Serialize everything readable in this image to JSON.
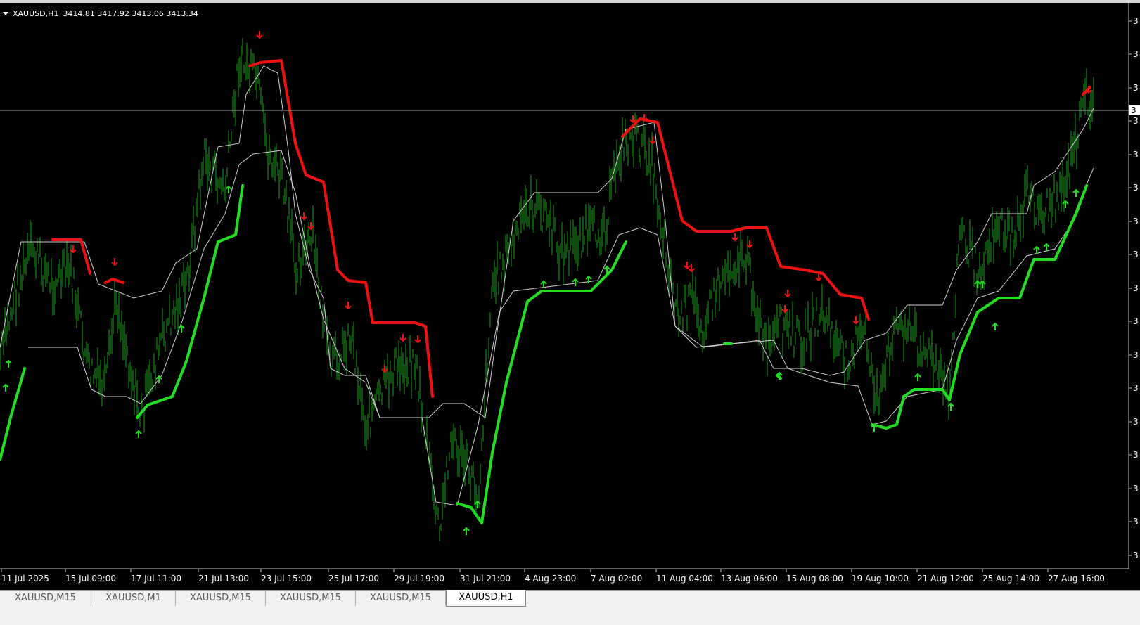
{
  "header": {
    "symbol": "XAUUSD,H1",
    "ohlc": "3414.81 3417.92 3413.06 3413.34"
  },
  "time_axis": {
    "labels": [
      "11 Jul 2025",
      "15 Jul 09:00",
      "17 Jul 11:00",
      "21 Jul 13:00",
      "23 Jul 15:00",
      "25 Jul 17:00",
      "29 Jul 19:00",
      "31 Jul 21:00",
      "4 Aug 23:00",
      "7 Aug 02:00",
      "11 Aug 04:00",
      "13 Aug 06:00",
      "15 Aug 08:00",
      "19 Aug 10:00",
      "21 Aug 12:00",
      "25 Aug 14:00",
      "27 Aug 16:00"
    ]
  },
  "price_axis": {
    "visible_prefix": "3",
    "current_price_marker": "3"
  },
  "tabs": [
    {
      "label": "XAUUSD,M15",
      "active": false
    },
    {
      "label": "XAUUSD,M1",
      "active": false
    },
    {
      "label": "XAUUSD,M15",
      "active": false
    },
    {
      "label": "XAUUSD,M15",
      "active": false
    },
    {
      "label": "XAUUSD,M15",
      "active": false
    },
    {
      "label": "XAUUSD,H1",
      "active": true
    }
  ],
  "colors": {
    "background": "#000000",
    "price_bars": "#1f9b1f",
    "trend_up": "#22dd22",
    "trend_down": "#ee1111",
    "channel_line": "#d0d0d0",
    "arrow_up": "#22dd22",
    "arrow_down": "#ee1111"
  }
}
